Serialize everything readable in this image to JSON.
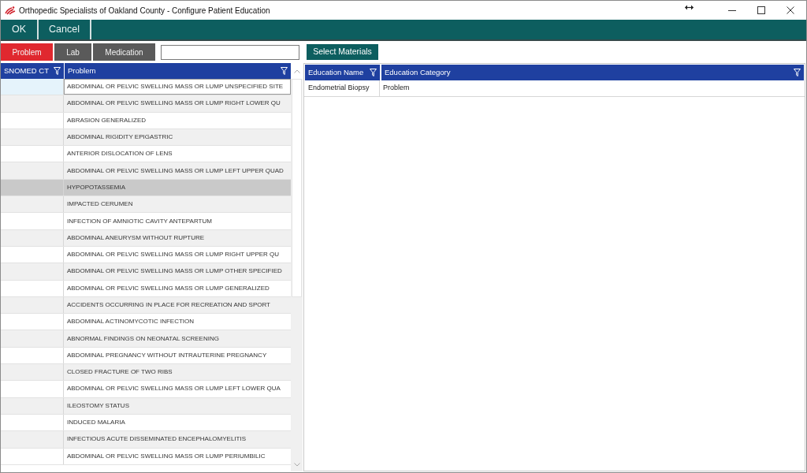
{
  "window": {
    "title": "Orthopedic Specialists of Oakland County - Configure Patient Education"
  },
  "toolbar": {
    "buttons": [
      {
        "label": "OK"
      },
      {
        "label": "Cancel"
      }
    ]
  },
  "category_tabs": [
    {
      "label": "Problem",
      "selected": true
    },
    {
      "label": "Lab",
      "selected": false
    },
    {
      "label": "Medication",
      "selected": false
    }
  ],
  "select_button": {
    "label": "Select Materials"
  },
  "problem_grid": {
    "columns": [
      {
        "label": "SNOMED CT"
      },
      {
        "label": "Problem"
      }
    ],
    "rows": [
      {
        "problem": "ABDOMINAL OR PELVIC SWELLING MASS OR LUMP UNSPECIFIED SITE",
        "selected": false,
        "current": true
      },
      {
        "problem": "ABDOMINAL OR PELVIC SWELLING MASS OR LUMP RIGHT LOWER QU",
        "selected": false,
        "current": false
      },
      {
        "problem": "ABRASION GENERALIZED",
        "selected": false,
        "current": false
      },
      {
        "problem": "ABDOMINAL RIGIDITY EPIGASTRIC",
        "selected": false,
        "current": false
      },
      {
        "problem": "ANTERIOR DISLOCATION OF LENS",
        "selected": false,
        "current": false
      },
      {
        "problem": "ABDOMINAL OR PELVIC SWELLING MASS OR LUMP LEFT UPPER QUAD",
        "selected": false,
        "current": false
      },
      {
        "problem": "HYPOPOTASSEMIA",
        "selected": true,
        "current": false
      },
      {
        "problem": "IMPACTED CERUMEN",
        "selected": false,
        "current": false
      },
      {
        "problem": "INFECTION OF AMNIOTIC CAVITY ANTEPARTUM",
        "selected": false,
        "current": false
      },
      {
        "problem": "ABDOMINAL ANEURYSM WITHOUT RUPTURE",
        "selected": false,
        "current": false
      },
      {
        "problem": "ABDOMINAL OR PELVIC SWELLING MASS OR LUMP RIGHT UPPER QU",
        "selected": false,
        "current": false
      },
      {
        "problem": "ABDOMINAL OR PELVIC SWELLING MASS OR LUMP OTHER SPECIFIED",
        "selected": false,
        "current": false
      },
      {
        "problem": "ABDOMINAL OR PELVIC SWELLING MASS OR LUMP GENERALIZED",
        "selected": false,
        "current": false
      },
      {
        "problem": "ACCIDENTS OCCURRING IN PLACE FOR RECREATION AND SPORT",
        "selected": false,
        "current": false
      },
      {
        "problem": "ABDOMINAL ACTINOMYCOTIC INFECTION",
        "selected": false,
        "current": false
      },
      {
        "problem": "ABNORMAL FINDINGS ON NEONATAL SCREENING",
        "selected": false,
        "current": false
      },
      {
        "problem": "ABDOMINAL PREGNANCY WITHOUT INTRAUTERINE PREGNANCY",
        "selected": false,
        "current": false
      },
      {
        "problem": "CLOSED FRACTURE OF TWO RIBS",
        "selected": false,
        "current": false
      },
      {
        "problem": "ABDOMINAL OR PELVIC SWELLING MASS OR LUMP LEFT LOWER QUA",
        "selected": false,
        "current": false
      },
      {
        "problem": "ILEOSTOMY STATUS",
        "selected": false,
        "current": false
      },
      {
        "problem": "INDUCED MALARIA",
        "selected": false,
        "current": false
      },
      {
        "problem": "INFECTIOUS ACUTE DISSEMINATED ENCEPHALOMYELITIS",
        "selected": false,
        "current": false
      },
      {
        "problem": "ABDOMINAL OR PELVIC SWELLING MASS OR LUMP PERIUMBILIC",
        "selected": false,
        "current": false
      }
    ]
  },
  "education_grid": {
    "columns": [
      {
        "label": "Education Name"
      },
      {
        "label": "Education Category"
      }
    ],
    "rows": [
      [
        "Endometrial Biopsy",
        "Problem"
      ]
    ]
  }
}
